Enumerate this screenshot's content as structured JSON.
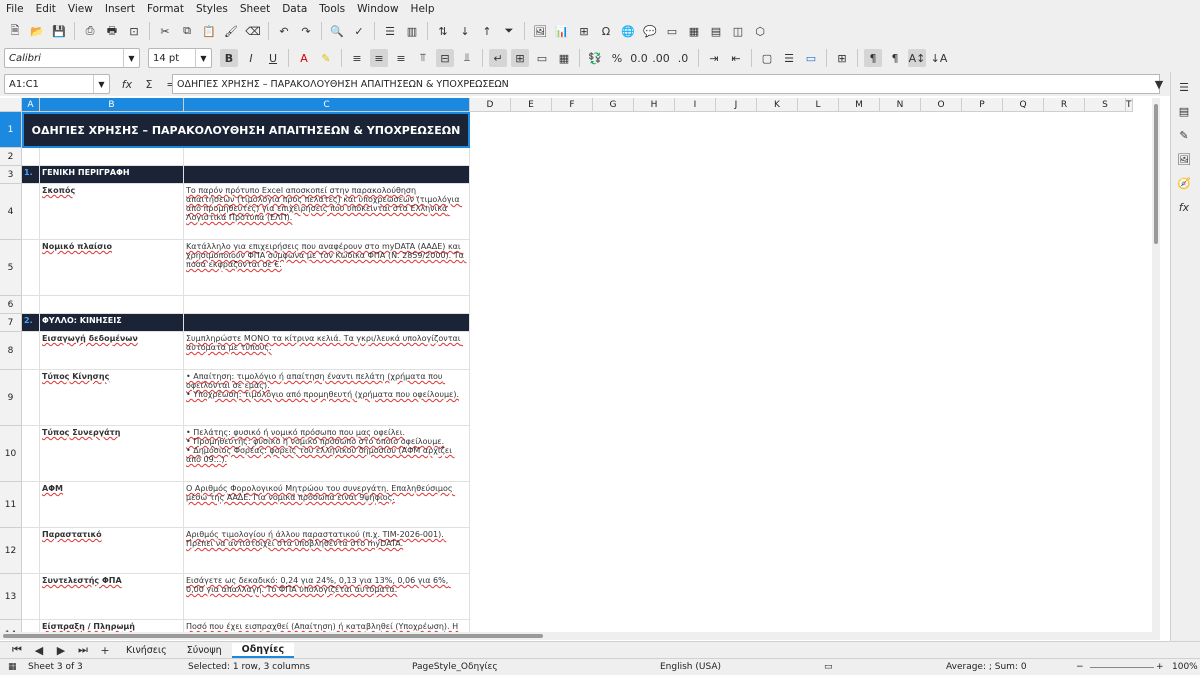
{
  "menu": [
    "File",
    "Edit",
    "View",
    "Insert",
    "Format",
    "Styles",
    "Sheet",
    "Data",
    "Tools",
    "Window",
    "Help"
  ],
  "font": {
    "name": "Calibri",
    "size": "14 pt"
  },
  "namebox": "A1:C1",
  "formula": "ΟΔΗΓΙΕΣ ΧΡΗΣΗΣ – ΠΑΡΑΚΟΛΟΥΘΗΣΗ ΑΠΑΙΤΗΣΕΩΝ & ΥΠΟΧΡΕΩΣΕΩΝ",
  "columns": [
    "A",
    "B",
    "C",
    "D",
    "E",
    "F",
    "G",
    "H",
    "I",
    "J",
    "K",
    "L",
    "M",
    "N",
    "O",
    "P",
    "Q",
    "R",
    "S",
    "T"
  ],
  "rows": [
    {
      "n": "1",
      "t": "ΟΔΗΓΙΕΣ ΧΡΗΣΗΣ – ΠΑΡΑΚΟΛΟΥΘΗΣΗ ΑΠΑΙΤΗΣΕΩΝ & ΥΠΟΧΡΕΩΣΕΩΝ"
    },
    {
      "n": "2"
    },
    {
      "n": "3",
      "a": "1.",
      "b": "ΓΕΝΙΚΗ ΠΕΡΙΓΡΑΦΗ"
    },
    {
      "n": "4",
      "b": "Σκοπός",
      "c": "Το παρόν πρότυπο Excel αποσκοπεί στην παρακολούθηση απαιτήσεων (τιμολόγια προς πελάτες) και υποχρεώσεων (τιμολόγια από προμηθευτές) για επιχειρήσεις που υπόκεινται στα Ελληνικά Λογιστικά Πρότυπα (ΕΛΠ)."
    },
    {
      "n": "5",
      "b": "Νομικό πλαίσιο",
      "c": "Κατάλληλο για επιχειρήσεις που αναφέρουν στο myDATA (ΑΑΔΕ) και χρησιμοποιούν ΦΠΑ σύμφωνα με τον Κώδικα ΦΠΑ (Ν. 2859/2000). Τα ποσά εκφράζονται σε €."
    },
    {
      "n": "6"
    },
    {
      "n": "7",
      "a": "2.",
      "b": "ΦΥΛΛΟ: ΚΙΝΗΣΕΙΣ"
    },
    {
      "n": "8",
      "b": "Εισαγωγή δεδομένων",
      "c": "Συμπληρώστε ΜΟΝΟ τα κίτρινα κελιά. Τα γκρι/λευκά υπολογίζονται αυτόματα με τύπους."
    },
    {
      "n": "9",
      "b": "Τύπος Κίνησης",
      "c": "• Απαίτηση: τιμολόγιο ή απαίτηση έναντι πελάτη (χρήματα που οφείλονται σε εμάς).\n• Υποχρέωση: τιμολόγιο από προμηθευτή (χρήματα που οφείλουμε)."
    },
    {
      "n": "10",
      "b": "Τύπος Συνεργάτη",
      "c": "• Πελάτης: φυσικό ή νομικό πρόσωπο που μας οφείλει.\n• Προμηθευτής: φυσικό ή νομικό πρόσωπο στο οποίο οφείλουμε.\n• Δημόσιος Φορέας: φορείς του ελληνικού δημοσίου (ΑΦΜ αρχίζει από 09...)."
    },
    {
      "n": "11",
      "b": "ΑΦΜ",
      "c": "Ο Αριθμός Φορολογικού Μητρώου του συνεργάτη. Επαληθεύσιμος μέσω της ΑΑΔΕ. Για νομικά πρόσωπα είναι 9ψήφιος."
    },
    {
      "n": "12",
      "b": "Παραστατικό",
      "c": "Αριθμός τιμολογίου ή άλλου παραστατικού (π.χ. ΤΙΜ-2026-001). Πρέπει να αντιστοιχεί στα υποβληθέντα στο myDATA."
    },
    {
      "n": "13",
      "b": "Συντελεστής ΦΠΑ",
      "c": "Εισάγετε ως δεκαδικό: 0,24 για 24%, 0,13 για 13%, 0,06 για 6%, 0,00 για απαλλαγή. Το ΦΠΑ υπολογίζεται αυτόματα."
    },
    {
      "n": "14",
      "b": "Είσπραξη / Πληρωμή",
      "c": "Ποσό που έχει εισπραχθεί (Απαίτηση) ή καταβληθεί (Υποχρέωση). Η Κατάσταση ενημερώνεται αυτόματα."
    }
  ],
  "tabs": [
    "Κινήσεις",
    "Σύνοψη",
    "Οδηγίες"
  ],
  "status": {
    "sheet": "Sheet 3 of 3",
    "selected": "Selected: 1 row, 3 columns",
    "pagestyle": "PageStyle_Οδηγίες",
    "lang": "English (USA)",
    "sum": "Average: ; Sum: 0",
    "zoom": "100%"
  }
}
